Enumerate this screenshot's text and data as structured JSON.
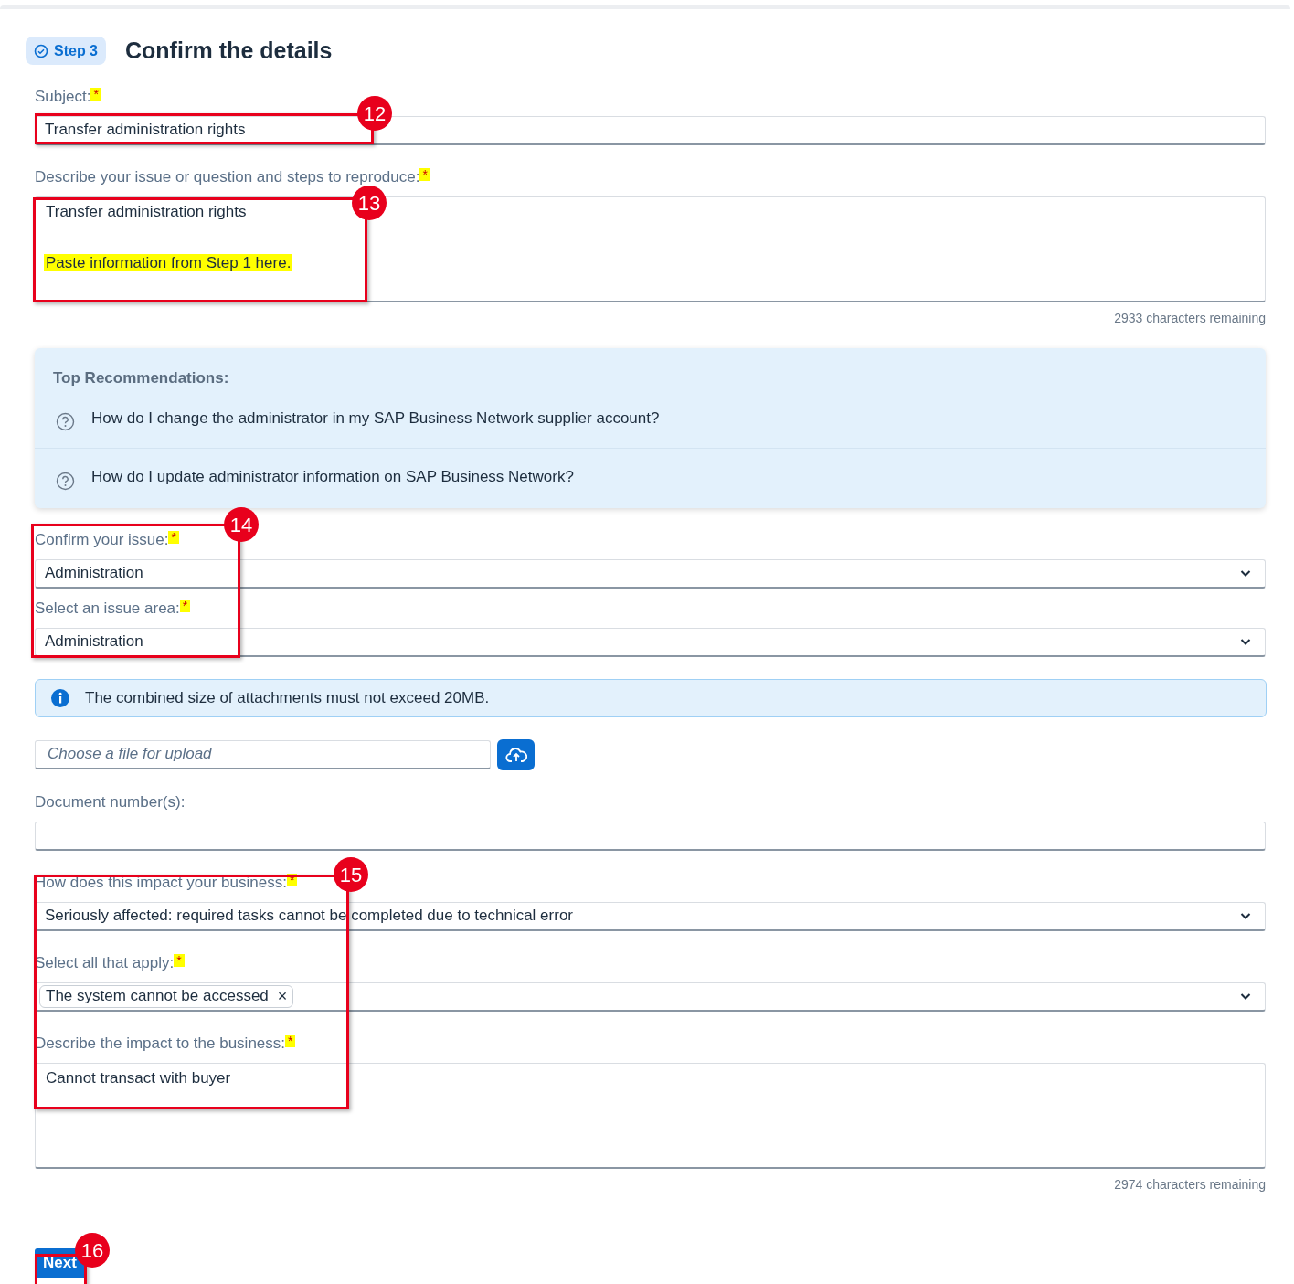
{
  "header": {
    "step_badge": "Step 3",
    "title": "Confirm the details"
  },
  "items": [
    {
      "kind": "text",
      "label": "Subject:",
      "required": true,
      "value": "Transfer administration rights"
    },
    {
      "kind": "textarea",
      "label": "Describe your issue or question and steps to reproduce:",
      "required": true,
      "lines": [
        {
          "text": "Transfer administration rights",
          "highlighted": false
        },
        {
          "text": "Paste information from Step 1 here.",
          "highlighted": true
        }
      ],
      "counter": "2933 characters remaining"
    },
    {
      "kind": "recommendations",
      "title": "Top Recommendations:",
      "links": [
        "How do I change the administrator in my SAP Business Network supplier account?",
        "How do I update administrator information on SAP Business Network?"
      ]
    },
    {
      "kind": "select",
      "label": "Confirm your issue:",
      "required": true,
      "value": "Administration"
    },
    {
      "kind": "select",
      "label": "Select an issue area:",
      "required": true,
      "value": "Administration"
    },
    {
      "kind": "info",
      "text": "The combined size of attachments must not exceed 20MB."
    },
    {
      "kind": "file",
      "placeholder": "Choose a file for upload"
    },
    {
      "kind": "text",
      "label": "Document number(s):",
      "required": false,
      "value": ""
    },
    {
      "kind": "select",
      "label": "How does this impact your business:",
      "required": true,
      "value": "Seriously affected: required tasks cannot be completed due to technical error"
    },
    {
      "kind": "multiselect",
      "label": "Select all that apply:",
      "required": true,
      "tokens": [
        "The system cannot be accessed"
      ],
      "token_remove": "×"
    },
    {
      "kind": "textarea",
      "label": "Describe the impact to the business:",
      "required": true,
      "lines": [
        {
          "text": "Cannot transact with buyer",
          "highlighted": false
        }
      ],
      "counter": "2974 characters remaining"
    }
  ],
  "next_button": "Next",
  "required_mark": "*",
  "annotations": [
    "12",
    "13",
    "14",
    "15",
    "16"
  ]
}
